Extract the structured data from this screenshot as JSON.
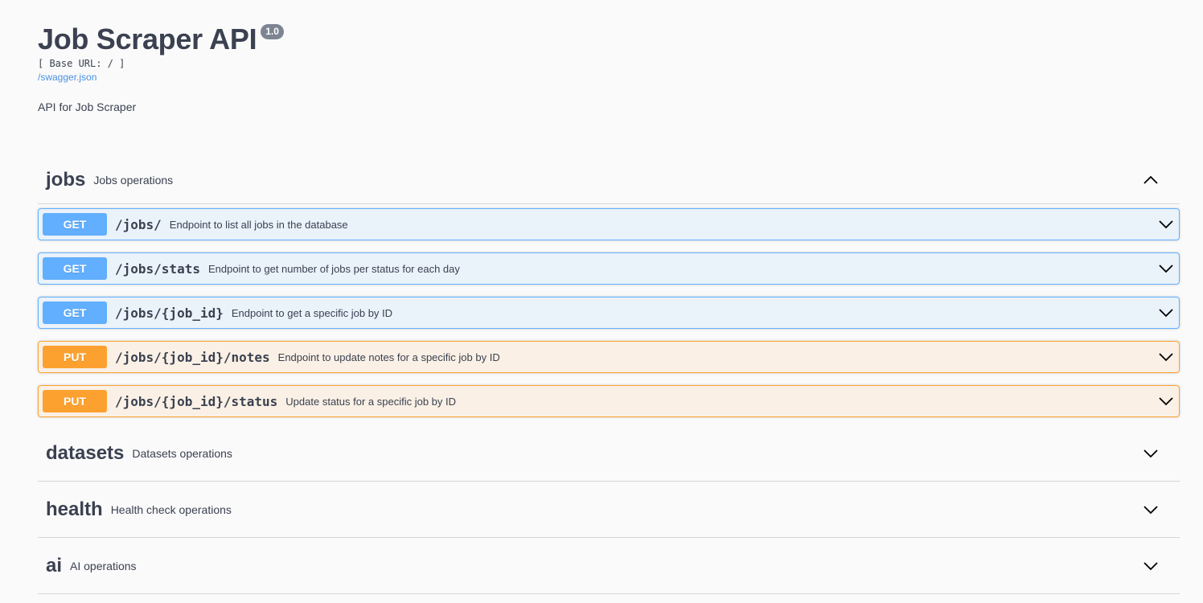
{
  "info": {
    "title": "Job Scraper API",
    "version": "1.0",
    "base_url": "[ Base URL: / ]",
    "spec_link": "/swagger.json",
    "description": "API for Job Scraper"
  },
  "tags": [
    {
      "name": "jobs",
      "description": "Jobs operations",
      "expanded": true,
      "operations": [
        {
          "method": "GET",
          "path": "/jobs/",
          "summary": "Endpoint to list all jobs in the database"
        },
        {
          "method": "GET",
          "path": "/jobs/stats",
          "summary": "Endpoint to get number of jobs per status for each day"
        },
        {
          "method": "GET",
          "path": "/jobs/{job_id}",
          "summary": "Endpoint to get a specific job by ID"
        },
        {
          "method": "PUT",
          "path": "/jobs/{job_id}/notes",
          "summary": "Endpoint to update notes for a specific job by ID"
        },
        {
          "method": "PUT",
          "path": "/jobs/{job_id}/status",
          "summary": "Update status for a specific job by ID"
        }
      ]
    },
    {
      "name": "datasets",
      "description": "Datasets operations",
      "expanded": false
    },
    {
      "name": "health",
      "description": "Health check operations",
      "expanded": false
    },
    {
      "name": "ai",
      "description": "AI operations",
      "expanded": false
    }
  ],
  "icons": {
    "collapse": "chevron-up-icon",
    "expand": "chevron-down-icon"
  },
  "colors": {
    "get": "#61affe",
    "put": "#fca130",
    "text": "#3b4151",
    "link": "#4990e2",
    "version_badge": "#7d8492"
  }
}
